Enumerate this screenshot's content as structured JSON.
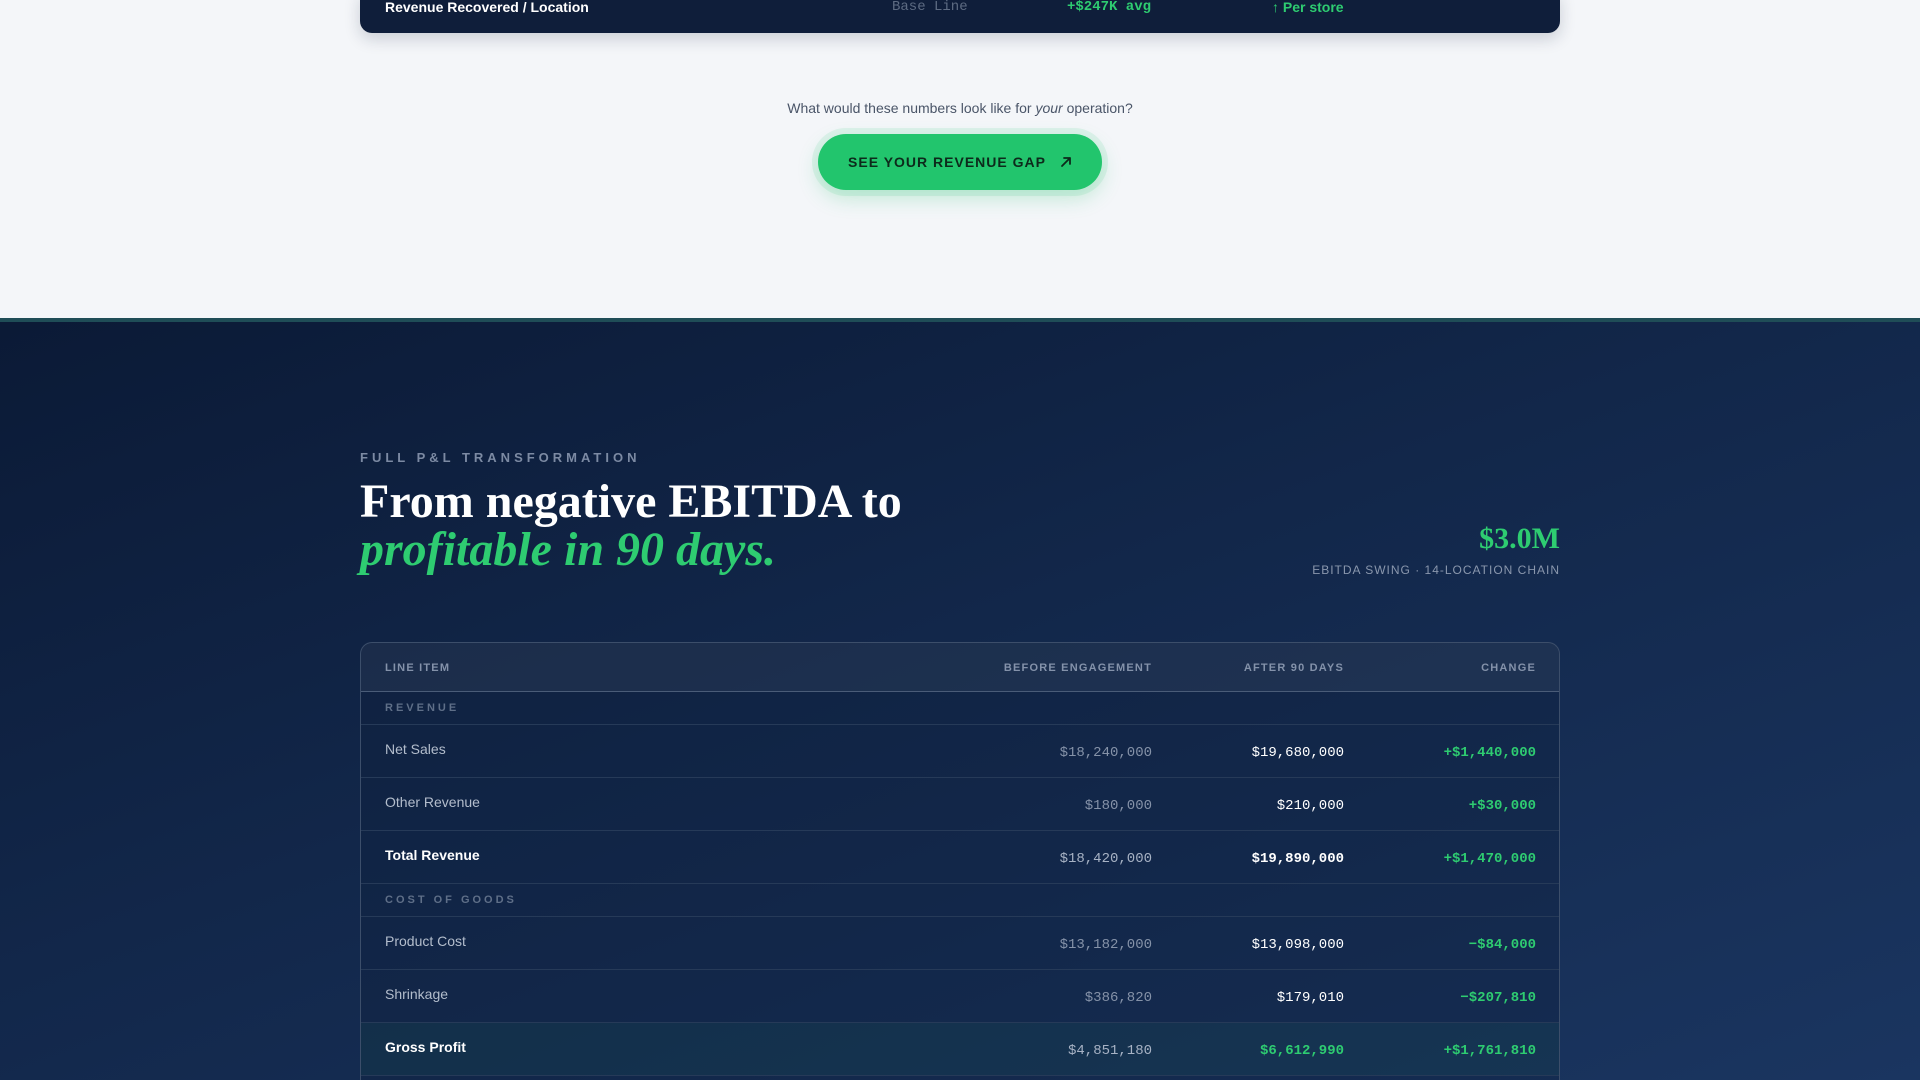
{
  "previous_table": {
    "label": "Revenue Recovered / Location",
    "baseline": "Base Line",
    "average": "+$247K avg",
    "per_store": "↑ Per store"
  },
  "cta": {
    "question_prefix": "What would these numbers look like for ",
    "question_emphasis": "your",
    "question_suffix": " operation?",
    "button_label": "SEE YOUR REVENUE GAP",
    "button_icon": "arrow-up-right-icon"
  },
  "pl_section": {
    "eyebrow": "FULL P&L TRANSFORMATION",
    "headline_line1": "From negative EBITDA to",
    "headline_line2": "profitable in 90 days.",
    "stat_value": "$3.0M",
    "stat_caption": "EBITDA SWING · 14-LOCATION CHAIN",
    "table": {
      "headers": {
        "line_item": "LINE ITEM",
        "before": "BEFORE ENGAGEMENT",
        "after": "AFTER 90 DAYS",
        "change": "CHANGE"
      },
      "groups": [
        {
          "title": "REVENUE",
          "rows": [
            {
              "item": "Net Sales",
              "before": "$18,240,000",
              "after": "$19,680,000",
              "change": "+$1,440,000"
            },
            {
              "item": "Other Revenue",
              "before": "$180,000",
              "after": "$210,000",
              "change": "+$30,000"
            },
            {
              "item": "Total Revenue",
              "before": "$18,420,000",
              "after": "$19,890,000",
              "change": "+$1,470,000"
            }
          ]
        },
        {
          "title": "COST OF GOODS",
          "rows": [
            {
              "item": "Product Cost",
              "before": "$13,182,000",
              "after": "$13,098,000",
              "change": "−$84,000"
            },
            {
              "item": "Shrinkage",
              "before": "$386,820",
              "after": "$179,010",
              "change": "−$207,810"
            },
            {
              "item": "Gross Profit",
              "before": "$4,851,180",
              "after": "$6,612,990",
              "change": "+$1,761,810"
            }
          ]
        }
      ]
    }
  },
  "colors": {
    "accent_green": "#2ecc71",
    "dark_navy": "#0f1e3a",
    "light_background": "#f4f6f9"
  }
}
